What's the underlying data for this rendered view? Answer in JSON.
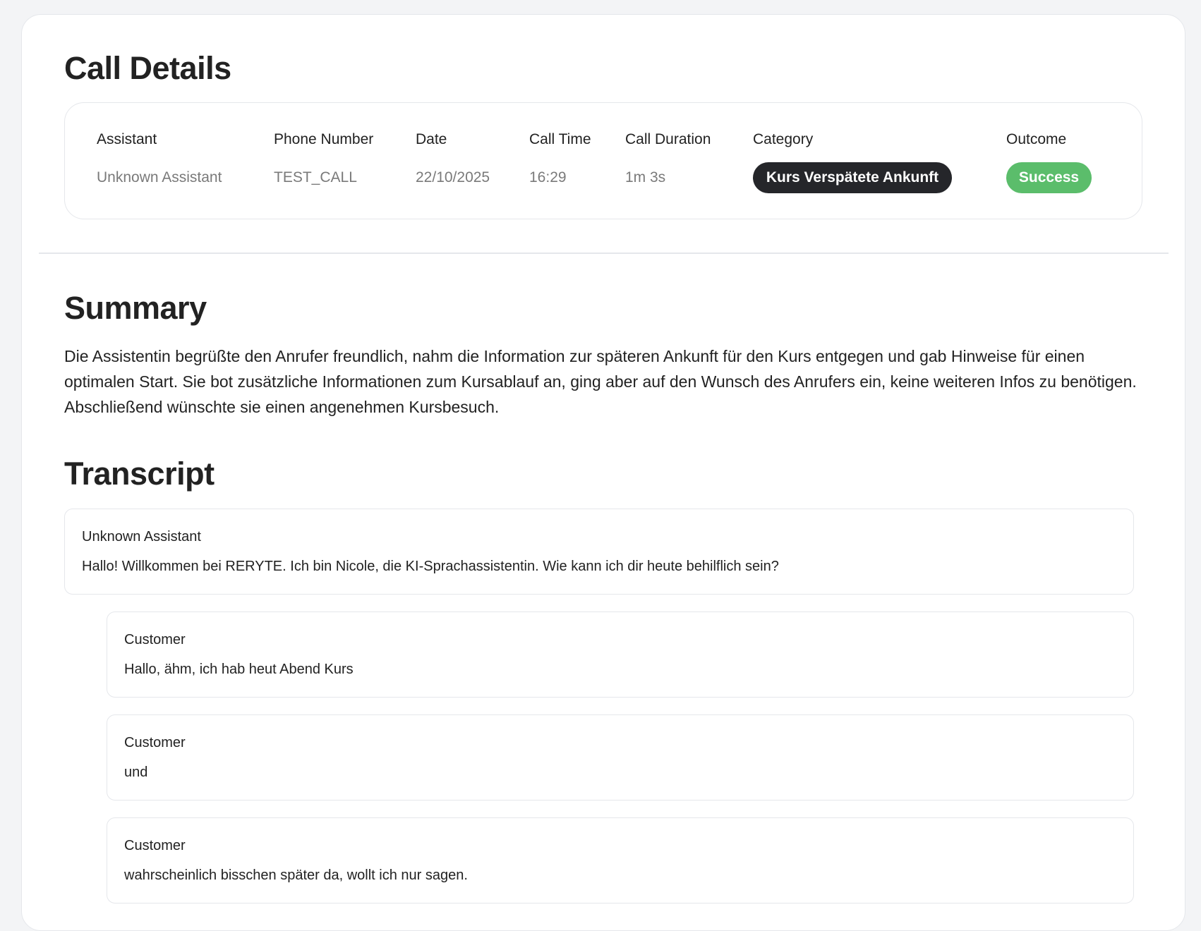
{
  "call_details": {
    "title": "Call Details",
    "headers": {
      "assistant": "Assistant",
      "phone_number": "Phone Number",
      "date": "Date",
      "call_time": "Call Time",
      "call_duration": "Call Duration",
      "category": "Category",
      "outcome": "Outcome"
    },
    "values": {
      "assistant": "Unknown Assistant",
      "phone_number": "TEST_CALL",
      "date": "22/10/2025",
      "call_time": "16:29",
      "call_duration": "1m 3s",
      "category": "Kurs Verspätete Ankunft",
      "outcome": "Success"
    },
    "colors": {
      "category_badge": "#25262a",
      "outcome_badge": "#5bbd6b"
    }
  },
  "summary": {
    "title": "Summary",
    "text": "Die Assistentin begrüßte den Anrufer freundlich, nahm die Information zur späteren Ankunft für den Kurs entgegen und gab Hinweise für einen optimalen Start. Sie bot zusätzliche Informationen zum Kursablauf an, ging aber auf den Wunsch des Anrufers ein, keine weiteren Infos zu benötigen. Abschließend wünschte sie einen angenehmen Kursbesuch."
  },
  "transcript": {
    "title": "Transcript",
    "messages": [
      {
        "speaker": "Unknown Assistant",
        "text": "Hallo! Willkommen bei RERYTE. Ich bin Nicole, die KI-Sprachassistentin. Wie kann ich dir heute behilflich sein?"
      },
      {
        "speaker": "Customer",
        "text": "Hallo, ähm, ich hab heut Abend Kurs"
      },
      {
        "speaker": "Customer",
        "text": "und"
      },
      {
        "speaker": "Customer",
        "text": "wahrscheinlich bisschen später da, wollt ich nur sagen."
      }
    ]
  }
}
